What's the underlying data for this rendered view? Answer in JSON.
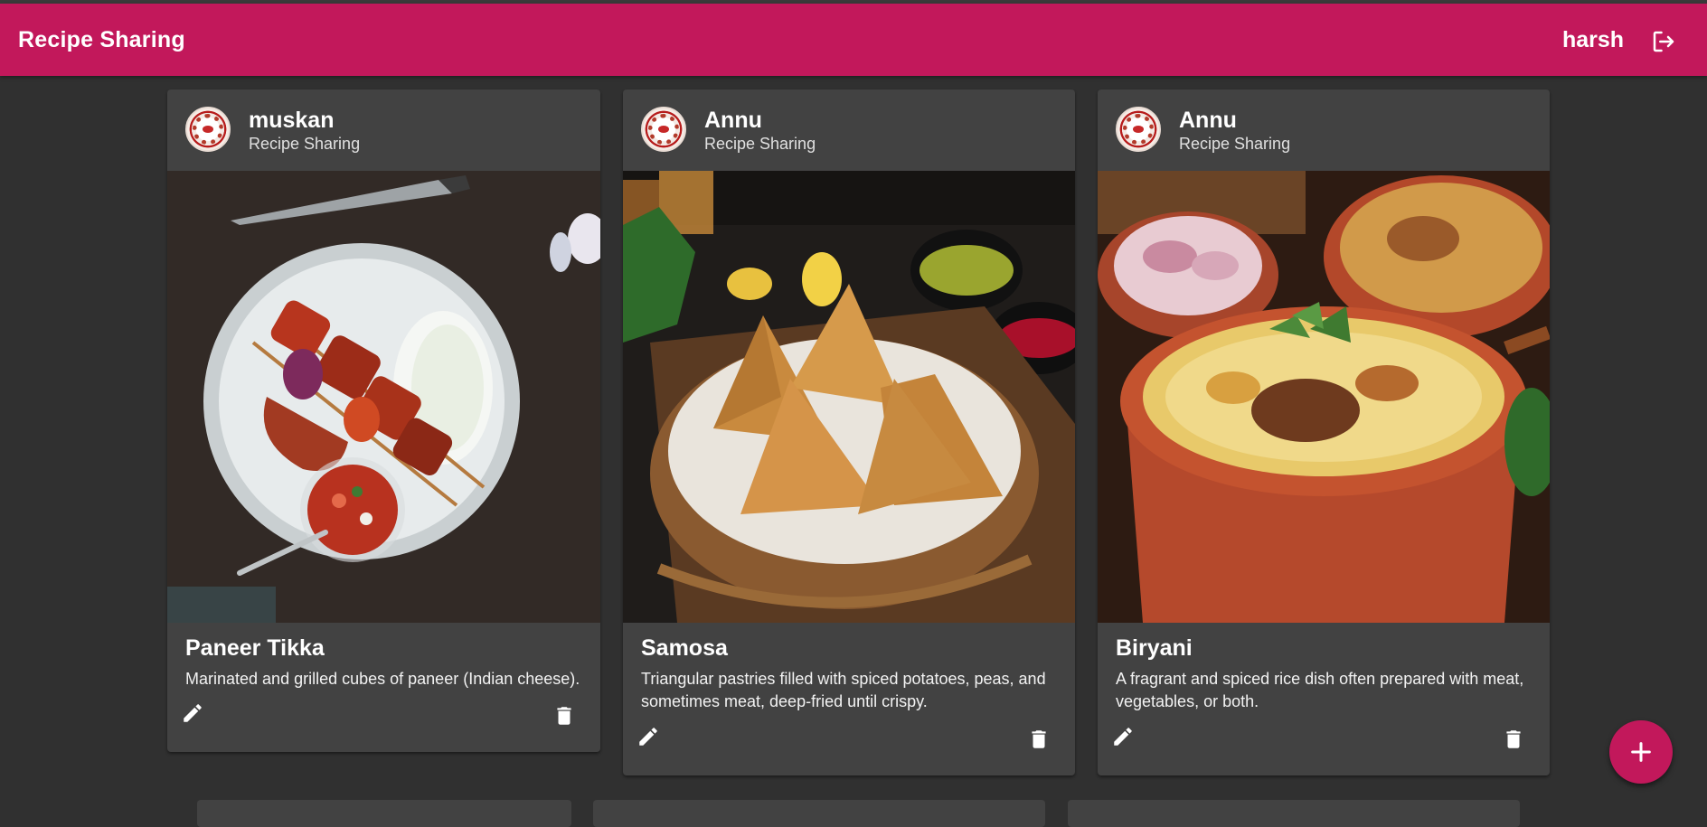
{
  "app": {
    "title": "Recipe Sharing",
    "user": "harsh",
    "brand_color": "#c2185b",
    "background": "#303030",
    "card_color": "#424242"
  },
  "icons": {
    "logout": "logout-icon",
    "edit": "pencil-icon",
    "delete": "trash-icon",
    "add": "plus-icon"
  },
  "recipes": [
    {
      "author": "muskan",
      "subheader": "Recipe Sharing",
      "title": "Paneer Tikka",
      "description": "Marinated and grilled cubes of paneer (Indian cheese).",
      "image": "paneer-tikka-photo"
    },
    {
      "author": "Annu",
      "subheader": "Recipe Sharing",
      "title": "Samosa",
      "description": "Triangular pastries filled with spiced potatoes, peas, and sometimes meat, deep-fried until crispy.",
      "image": "samosa-photo"
    },
    {
      "author": "Annu",
      "subheader": "Recipe Sharing",
      "title": "Biryani",
      "description": "A fragrant and spiced rice dish often prepared with meat, vegetables, or both.",
      "image": "biryani-photo"
    }
  ]
}
